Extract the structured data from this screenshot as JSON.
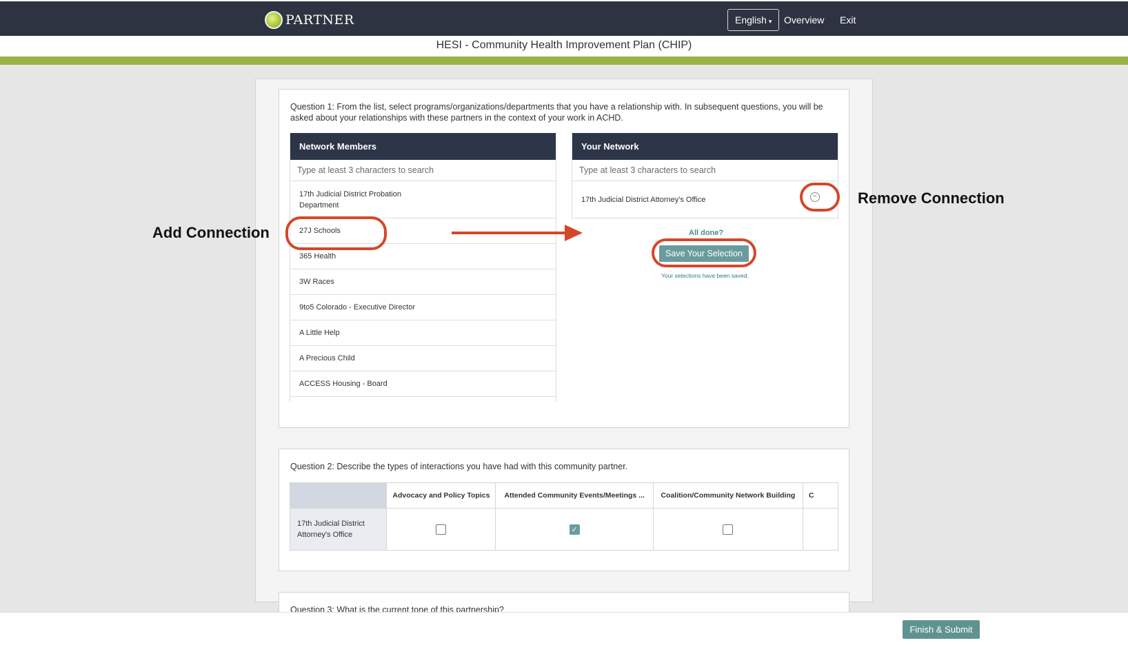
{
  "nav": {
    "logo_text": "PARTNER",
    "language": "English",
    "overview": "Overview",
    "exit": "Exit"
  },
  "survey_title": "HESI - Community Health Improvement Plan (CHIP)",
  "question1": {
    "text": "Question 1: From the list, select programs/organizations/departments that you have a relationship with. In subsequent questions, you will be asked about your relationships with these partners in the context of your work in ACHD.",
    "network_members": {
      "header": "Network Members",
      "search_placeholder": "Type at least 3 characters to search",
      "items": [
        "17th Judicial District Probation Department",
        "27J Schools",
        "365 Health",
        "3W Races",
        "9to5 Colorado - Executive Director",
        "A Little Help",
        "A Precious Child",
        "ACCESS Housing - Board"
      ]
    },
    "your_network": {
      "header": "Your Network",
      "search_placeholder": "Type at least 3 characters to search",
      "items": [
        "17th Judicial District Attorney's Office"
      ]
    },
    "all_done": "All done?",
    "save_button": "Save Your Selection",
    "saved_message": "Your selections have been saved."
  },
  "annotations": {
    "add_connection": "Add Connection",
    "remove_connection": "Remove Connection",
    "accent_color": "#d5472a"
  },
  "question2": {
    "text": "Question 2: Describe the types of interactions you have had with this community partner.",
    "columns": [
      "Advocacy and Policy Topics",
      "Attended Community Events/Meetings ...",
      "Coalition/Community Network Building",
      "C"
    ],
    "rows": [
      {
        "label": "17th Judicial District Attorney's Office",
        "checked": [
          false,
          true,
          false
        ]
      }
    ]
  },
  "question3": {
    "text": "Question 3: What is the current tone of this partnership?"
  },
  "finish_button": "Finish & Submit",
  "colors": {
    "navbar": "#2d3340",
    "green_bar": "#99b347",
    "button_teal": "#6a9c9d",
    "panel_header": "#2d3648"
  }
}
